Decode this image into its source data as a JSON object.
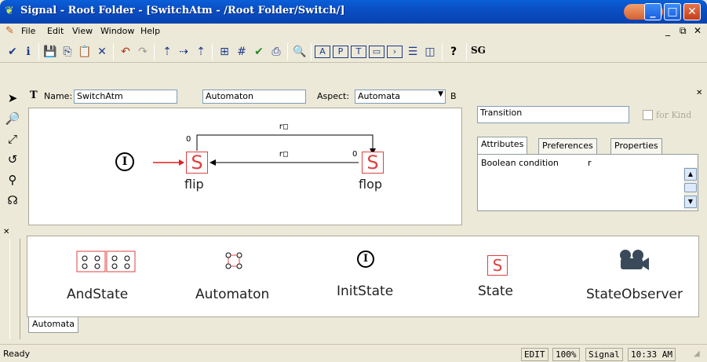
{
  "window": {
    "title": "Signal - Root Folder - [SwitchAtm - /Root Folder/Switch/]"
  },
  "menu": [
    "File",
    "Edit",
    "View",
    "Window",
    "Help"
  ],
  "toolbar": {
    "sg_label": "SG"
  },
  "namebar": {
    "name_label": "Name:",
    "name_value": "SwitchAtm",
    "kind_value": "Automaton",
    "aspect_label": "Aspect:",
    "aspect_value": "Automata",
    "b_label": "B"
  },
  "diagram": {
    "init_glyph": "I",
    "state_glyph": "S",
    "flip_label": "flip",
    "flop_label": "flop",
    "top_edge_label": "r□",
    "mid_edge_label": "r□",
    "flip_priority": "0",
    "flop_priority": "0"
  },
  "inspector": {
    "kind_value": "Transition",
    "for_kind_label": "for Kind",
    "tabs": [
      "Attributes",
      "Preferences",
      "Properties"
    ],
    "attribute_name": "Boolean condition",
    "attribute_value": "r"
  },
  "palette": {
    "items": [
      {
        "label": "AndState",
        "icon": "and-state-icon"
      },
      {
        "label": "Automaton",
        "icon": "automaton-icon"
      },
      {
        "label": "InitState",
        "icon": "init-state-icon"
      },
      {
        "label": "State",
        "icon": "state-icon"
      },
      {
        "label": "StateObserver",
        "icon": "state-observer-icon"
      }
    ],
    "tab_label": "Automata"
  },
  "status": {
    "text": "Ready",
    "mode": "EDIT",
    "zoom": "100%",
    "paradigm": "Signal",
    "time": "10:33 AM"
  },
  "colors": {
    "title_bar": "#0a4ec4",
    "state_red": "#e04040"
  }
}
